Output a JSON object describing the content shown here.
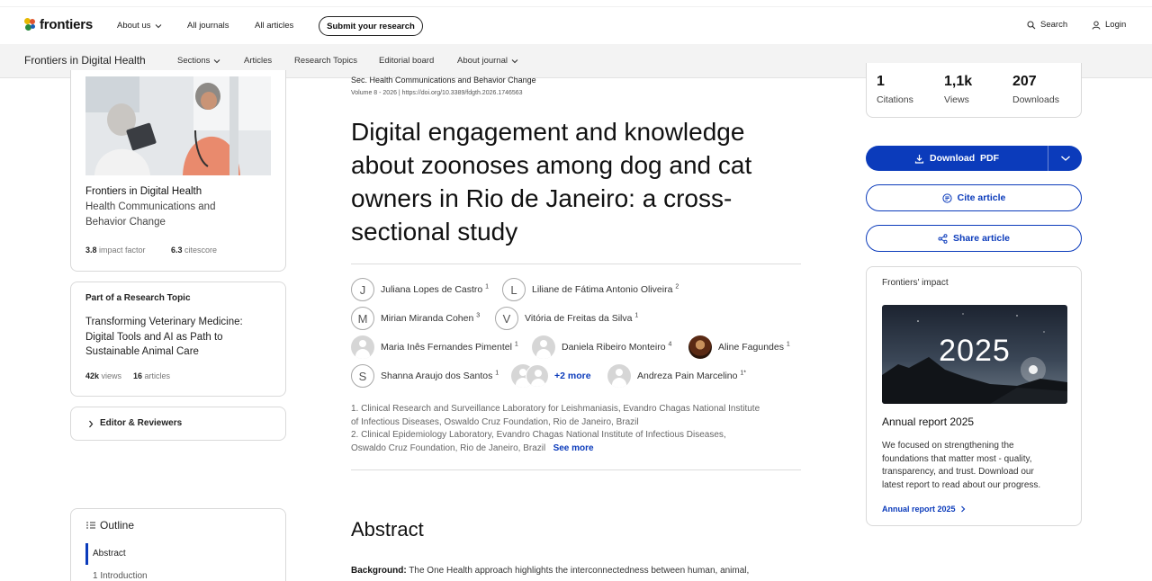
{
  "brand": {
    "logo_text": "frontiers"
  },
  "topnav": {
    "items": [
      "About us",
      "All journals",
      "All articles"
    ],
    "submit_label": "Submit your research",
    "search_label": "Search",
    "login_label": "Login"
  },
  "journal_nav": {
    "journal_name": "Frontiers in Digital Health",
    "items": [
      "Sections",
      "Articles",
      "Research Topics",
      "Editorial board",
      "About journal"
    ]
  },
  "journal_card": {
    "title": "Frontiers in Digital Health",
    "section_lines": [
      "Health Communications and",
      "Behavior Change"
    ],
    "impact_value": "3.8",
    "impact_label": "impact factor",
    "citescore_value": "6.3",
    "citescore_label": "citescore"
  },
  "topic_card": {
    "heading": "Part of a Research Topic",
    "title_lines": [
      "Transforming Veterinary Medicine:",
      "Digital Tools and AI as Path to",
      "Sustainable Animal Care"
    ],
    "views_value": "42k",
    "views_label": "views",
    "articles_value": "16",
    "articles_label": "articles"
  },
  "editor_card": {
    "label": "Editor & Reviewers"
  },
  "outline": {
    "heading": "Outline",
    "items": [
      "Abstract",
      "1 Introduction"
    ]
  },
  "article": {
    "section": "Sec. Health Communications and Behavior Change",
    "volume_line": "Volume 8 - 2026 | https://doi.org/10.3389/fdgth.2026.1746563",
    "title_lines": [
      "Digital engagement and knowledge",
      "about zoonoses among dog and cat",
      "owners in Rio de Janeiro: a cross-",
      "sectional study"
    ],
    "authors": [
      {
        "initial": "J",
        "name": "Juliana Lopes de Castro",
        "sup": "1"
      },
      {
        "initial": "L",
        "name": "Liliane de Fátima Antonio Oliveira",
        "sup": "2"
      },
      {
        "initial": "M",
        "name": "Mirian Miranda Cohen",
        "sup": "3"
      },
      {
        "initial": "V",
        "name": "Vitória de Freitas da Silva",
        "sup": "1"
      },
      {
        "initial": "",
        "name": "Maria Inês Fernandes Pimentel",
        "sup": "1"
      },
      {
        "initial": "",
        "name": "Daniela Ribeiro Monteiro",
        "sup": "4"
      },
      {
        "initial": "",
        "name": "Aline Fagundes",
        "sup": "1"
      },
      {
        "initial": "S",
        "name": "Shanna Araujo dos Santos",
        "sup": "1"
      },
      {
        "initial": "",
        "name": "Andreza Pain Marcelino",
        "sup": "1*"
      }
    ],
    "more_authors": "+2 more",
    "affiliations": [
      [
        "1. Clinical Research and Surveillance Laboratory for Leishmaniasis, Evandro Chagas National Institute",
        "of Infectious Diseases, Oswaldo Cruz Foundation, Rio de Janeiro, Brazil"
      ],
      [
        "2. Clinical Epidemiology Laboratory, Evandro Chagas National Institute of Infectious Diseases,",
        "Oswaldo Cruz Foundation, Rio de Janeiro, Brazil"
      ]
    ],
    "see_more": "See more",
    "abstract_heading": "Abstract",
    "abstract_label": "Background:",
    "abstract_text": "The One Health approach highlights the interconnectedness between human, animal,"
  },
  "metrics": {
    "citations_value": "1",
    "citations_label": "Citations",
    "views_value": "1,1k",
    "views_label": "Views",
    "downloads_value": "207",
    "downloads_label": "Downloads"
  },
  "actions": {
    "download_label": "Download  PDF",
    "cite_label": "Cite article",
    "share_label": "Share article"
  },
  "impact": {
    "heading": "Frontiers' impact",
    "image_text": "2025",
    "title": "Annual report 2025",
    "body_lines": [
      "We focused on strengthening the",
      "foundations that matter most - quality,",
      "transparency, and trust. Download our",
      "latest report to read about our progress."
    ],
    "link_label": "Annual report 2025"
  },
  "colors": {
    "accent": "#0b3bbb",
    "border": "#d9d9d9"
  }
}
